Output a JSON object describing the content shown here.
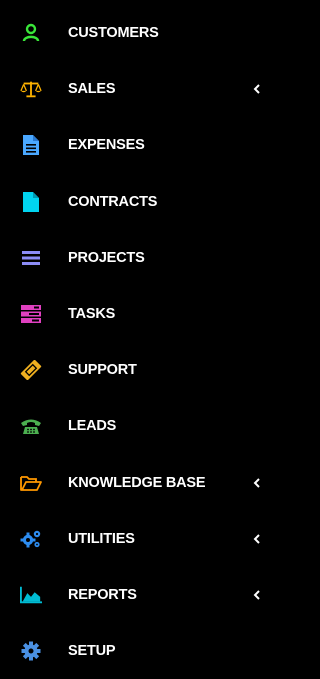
{
  "sidebar": {
    "items": [
      {
        "label": "CUSTOMERS",
        "icon": "user-icon",
        "color": "#39e639",
        "has_submenu": false
      },
      {
        "label": "SALES",
        "icon": "balance-scale-icon",
        "color": "#ffb300",
        "has_submenu": true
      },
      {
        "label": "EXPENSES",
        "icon": "file-text-icon",
        "color": "#4aa8ff",
        "has_submenu": false
      },
      {
        "label": "CONTRACTS",
        "icon": "file-icon",
        "color": "#00d4f0",
        "has_submenu": false
      },
      {
        "label": "PROJECTS",
        "icon": "bars-icon",
        "color": "#8c8cf5",
        "has_submenu": false
      },
      {
        "label": "TASKS",
        "icon": "tasks-icon",
        "color": "#e040c0",
        "has_submenu": false
      },
      {
        "label": "SUPPORT",
        "icon": "ticket-icon",
        "color": "#f0b020",
        "has_submenu": false
      },
      {
        "label": "LEADS",
        "icon": "phone-icon",
        "color": "#4caf50",
        "has_submenu": false
      },
      {
        "label": "KNOWLEDGE BASE",
        "icon": "folder-open-icon",
        "color": "#ff9800",
        "has_submenu": true
      },
      {
        "label": "UTILITIES",
        "icon": "cogs-icon",
        "color": "#2d8cf0",
        "has_submenu": true
      },
      {
        "label": "REPORTS",
        "icon": "area-chart-icon",
        "color": "#00bcd4",
        "has_submenu": true
      },
      {
        "label": "SETUP",
        "icon": "cog-icon",
        "color": "#4a90e2",
        "has_submenu": false
      }
    ],
    "chevron_color": "#ffffff"
  }
}
